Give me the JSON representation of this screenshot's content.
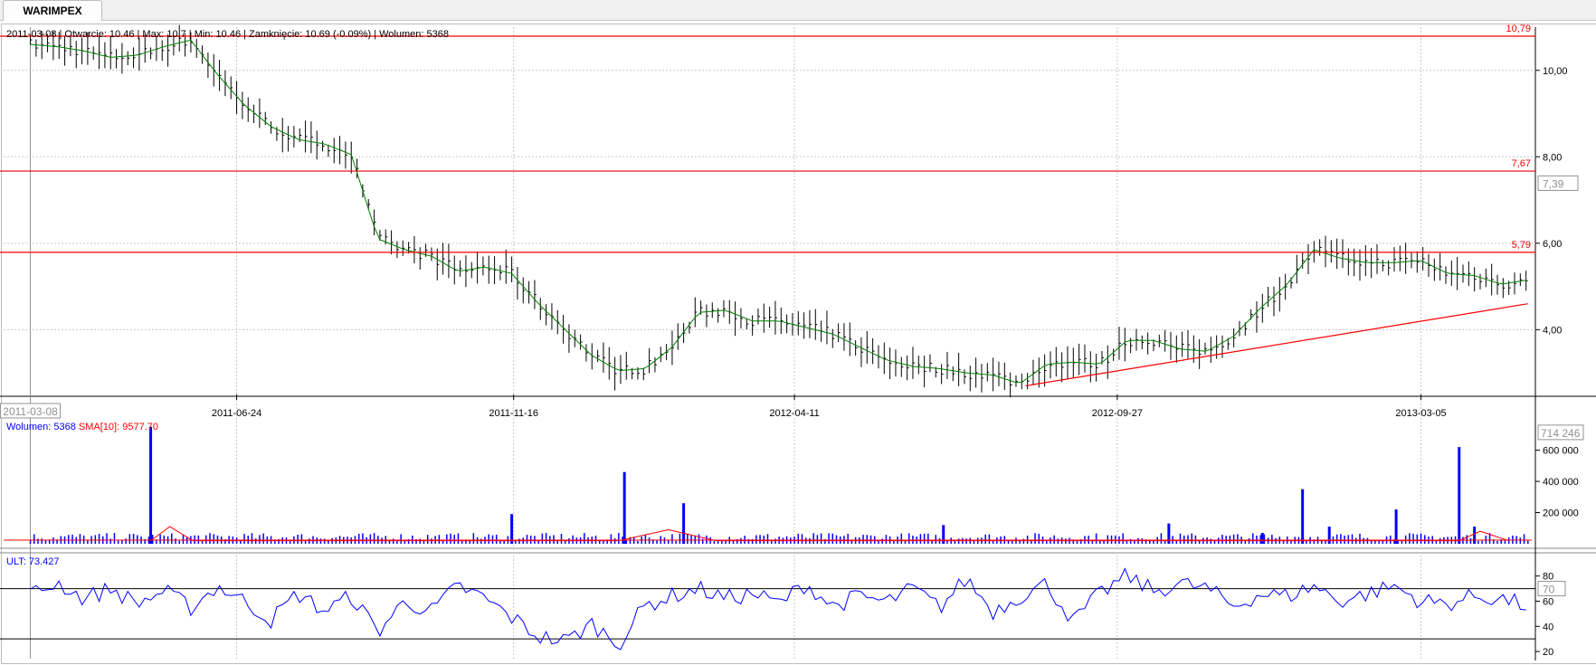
{
  "tab": {
    "label": "WARIMPEX"
  },
  "info": {
    "text": "2011-03-08 | Otwarcie: 10.46 | Max: 10.7 | Min: 10.46 | Zamknięcie: 10.69 (-0.09%)  | Wolumen: 5368"
  },
  "volume_panel": {
    "volume_label": "Wolumen: 5368",
    "sma_label": "SMA[10]: 9577.70"
  },
  "ult_panel": {
    "label": "ULT: 73.427"
  },
  "colors": {
    "bars": "#000000",
    "ma": "#008000",
    "levels": "#ff0000",
    "volume": "#0000ff",
    "sma": "#ff0000",
    "ult": "#0000ff",
    "grid": "#c8c8c8"
  },
  "chart_data": [
    {
      "type": "line",
      "kind": "price bars (OHLC) with moving average",
      "x_tick_labels": [
        "2011-06-24",
        "2011-11-16",
        "2012-04-11",
        "2012-09-27",
        "2013-03-05"
      ],
      "cursor_date_label": "2011-03-08",
      "y_tick_labels": [
        "4,00",
        "6,00",
        "8,00",
        "10,00"
      ],
      "ylim": [
        2.5,
        11.0
      ],
      "current_value_label": "7,39",
      "horizontal_levels": [
        {
          "value": 10.79,
          "label": "10,79"
        },
        {
          "value": 7.67,
          "label": "7,67"
        },
        {
          "value": 5.79,
          "label": "5,79"
        }
      ],
      "trendline": {
        "from": {
          "date": "2012-08-10",
          "value": 2.7
        },
        "to": {
          "date": "2013-04-30",
          "value": 4.6
        }
      },
      "series": [
        {
          "x": [
            "2011-03-08",
            "2011-03-22",
            "2011-04-05",
            "2011-04-19",
            "2011-05-03",
            "2011-05-17",
            "2011-05-31",
            "2011-06-14",
            "2011-06-28",
            "2011-07-12",
            "2011-07-26",
            "2011-08-09",
            "2011-08-23",
            "2011-09-06",
            "2011-09-20",
            "2011-10-04",
            "2011-10-18",
            "2011-11-01",
            "2011-11-15",
            "2011-11-29",
            "2011-12-13",
            "2011-12-27",
            "2012-01-10",
            "2012-01-24",
            "2012-02-07",
            "2012-02-21",
            "2012-03-06",
            "2012-03-20",
            "2012-04-03",
            "2012-04-17",
            "2012-05-01",
            "2012-05-15",
            "2012-05-29",
            "2012-06-12",
            "2012-06-26",
            "2012-07-10",
            "2012-07-24",
            "2012-08-07",
            "2012-08-21",
            "2012-09-04",
            "2012-09-18",
            "2012-10-02",
            "2012-10-16",
            "2012-10-30",
            "2012-11-13",
            "2012-11-27",
            "2012-12-11",
            "2012-12-25",
            "2013-01-08",
            "2013-01-22",
            "2013-02-05",
            "2013-02-19",
            "2013-03-05",
            "2013-03-19",
            "2013-04-02",
            "2013-04-16",
            "2013-04-30"
          ],
          "values": [
            10.6,
            10.55,
            10.45,
            10.3,
            10.35,
            10.55,
            10.7,
            9.9,
            9.2,
            8.7,
            8.4,
            8.3,
            8.05,
            6.1,
            5.85,
            5.7,
            5.35,
            5.45,
            5.3,
            4.6,
            4.0,
            3.4,
            3.05,
            3.1,
            3.6,
            4.4,
            4.45,
            4.2,
            4.2,
            4.05,
            3.9,
            3.6,
            3.3,
            3.15,
            3.1,
            3.0,
            2.95,
            2.75,
            3.2,
            3.25,
            3.2,
            3.75,
            3.75,
            3.55,
            3.5,
            3.85,
            4.5,
            5.05,
            5.85,
            5.65,
            5.55,
            5.55,
            5.6,
            5.3,
            5.25,
            5.05,
            5.15
          ]
        }
      ]
    },
    {
      "type": "bar",
      "title": "Wolumen",
      "y_tick_labels": [
        "200 000",
        "400 000",
        "600 000"
      ],
      "ylim": [
        0,
        760000
      ],
      "current_value_label": "714 246",
      "series": [
        {
          "name": "Wolumen",
          "x": [
            "2011-05-10",
            "2011-11-15",
            "2012-01-13",
            "2012-02-13",
            "2012-06-28",
            "2012-10-24",
            "2012-12-12",
            "2013-01-02",
            "2013-01-16",
            "2013-02-20",
            "2013-03-25",
            "2013-04-02"
          ],
          "values": [
            750000,
            190000,
            460000,
            260000,
            120000,
            130000,
            70000,
            350000,
            110000,
            220000,
            620000,
            110000
          ]
        },
        {
          "name": "SMA[10]",
          "x": [
            "2011-05-10",
            "2011-05-20",
            "2011-06-01",
            "2012-01-10",
            "2012-02-05",
            "2012-03-01",
            "2013-03-25",
            "2013-04-05",
            "2013-04-20"
          ],
          "values": [
            20000,
            110000,
            20000,
            20000,
            90000,
            20000,
            20000,
            80000,
            20000
          ]
        }
      ]
    },
    {
      "type": "line",
      "title": "ULT",
      "y_tick_labels": [
        "20",
        "40",
        "60",
        "80"
      ],
      "ylim": [
        15,
        92
      ],
      "reference_lines": [
        70,
        30
      ],
      "current_value_label": "70",
      "series": [
        {
          "name": "ULT",
          "x": [
            "2011-03-08",
            "2011-03-22",
            "2011-04-05",
            "2011-04-19",
            "2011-05-03",
            "2011-05-17",
            "2011-05-31",
            "2011-06-14",
            "2011-06-28",
            "2011-07-12",
            "2011-07-26",
            "2011-08-09",
            "2011-08-23",
            "2011-09-06",
            "2011-09-20",
            "2011-10-04",
            "2011-10-18",
            "2011-11-01",
            "2011-11-15",
            "2011-11-29",
            "2011-12-13",
            "2011-12-27",
            "2012-01-10",
            "2012-01-24",
            "2012-02-07",
            "2012-02-21",
            "2012-03-06",
            "2012-03-20",
            "2012-04-03",
            "2012-04-17",
            "2012-05-01",
            "2012-05-15",
            "2012-05-29",
            "2012-06-12",
            "2012-06-26",
            "2012-07-10",
            "2012-07-24",
            "2012-08-07",
            "2012-08-21",
            "2012-09-04",
            "2012-09-18",
            "2012-10-02",
            "2012-10-16",
            "2012-10-30",
            "2012-11-13",
            "2012-11-27",
            "2012-12-11",
            "2012-12-25",
            "2013-01-08",
            "2013-01-22",
            "2013-02-05",
            "2013-02-19",
            "2013-03-05",
            "2013-03-19",
            "2013-04-02",
            "2013-04-16",
            "2013-04-30"
          ],
          "values": [
            65,
            75,
            62,
            70,
            58,
            68,
            55,
            72,
            60,
            45,
            66,
            52,
            64,
            36,
            60,
            52,
            72,
            62,
            47,
            32,
            28,
            42,
            26,
            57,
            64,
            70,
            62,
            66,
            58,
            74,
            56,
            64,
            59,
            70,
            55,
            78,
            52,
            64,
            74,
            44,
            66,
            80,
            68,
            74,
            70,
            56,
            66,
            64,
            72,
            60,
            66,
            72,
            60,
            58,
            64,
            62,
            56
          ]
        }
      ]
    }
  ]
}
